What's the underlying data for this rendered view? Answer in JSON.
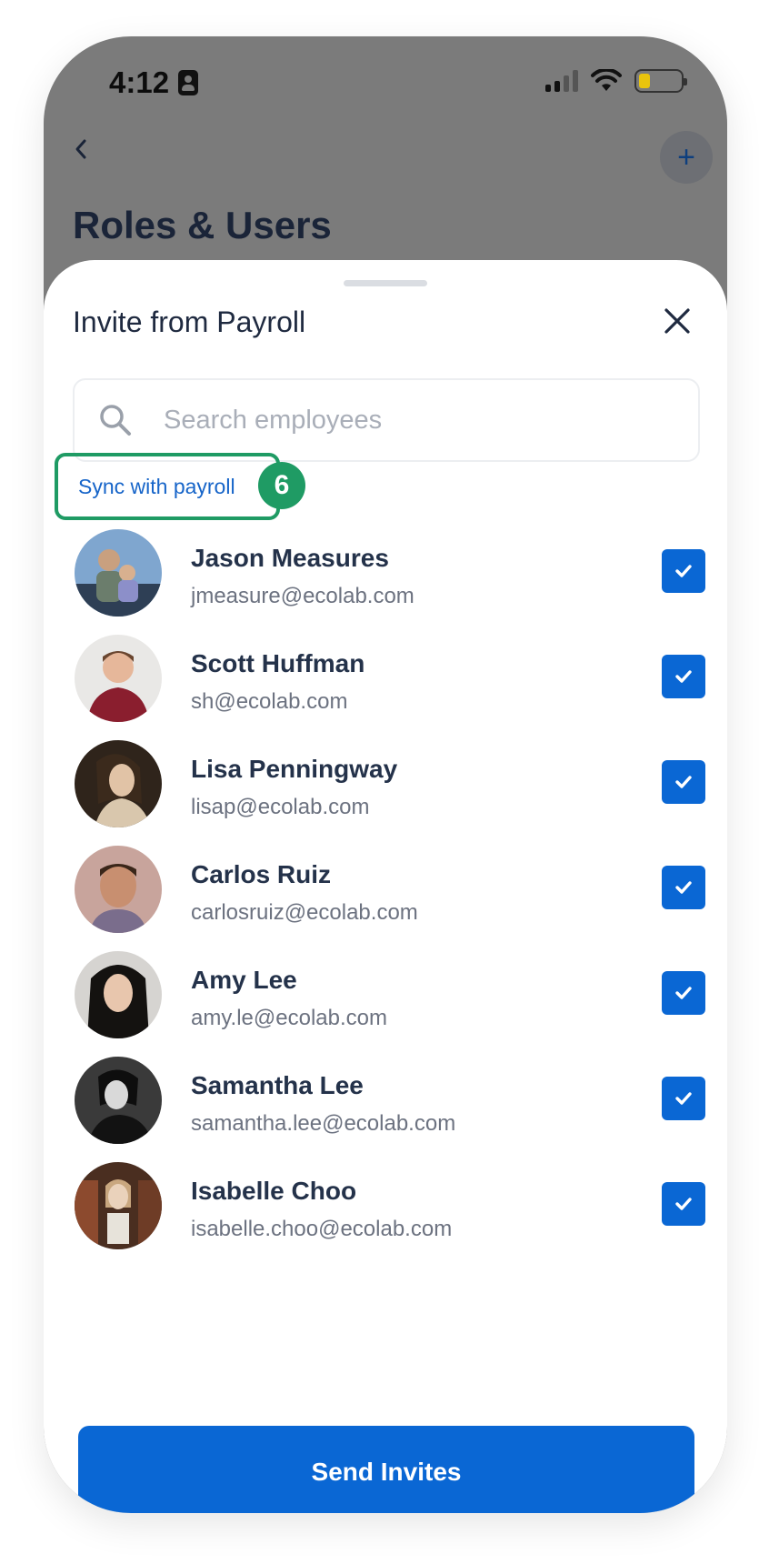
{
  "status": {
    "time": "4:12"
  },
  "header": {
    "title": "Roles & Users",
    "add_label": "+"
  },
  "sheet": {
    "title": "Invite from Payroll",
    "search": {
      "value": "",
      "placeholder": "Search employees"
    },
    "sync_label": "Sync with payroll",
    "step_number": "6",
    "employees": [
      {
        "name": "Jason Measures",
        "email": "jmeasure@ecolab.com",
        "checked": true
      },
      {
        "name": "Scott Huffman",
        "email": "sh@ecolab.com",
        "checked": true
      },
      {
        "name": "Lisa Penningway",
        "email": "lisap@ecolab.com",
        "checked": true
      },
      {
        "name": "Carlos Ruiz",
        "email": "carlosruiz@ecolab.com",
        "checked": true
      },
      {
        "name": "Amy Lee",
        "email": "amy.le@ecolab.com",
        "checked": true
      },
      {
        "name": "Samantha Lee",
        "email": "samantha.lee@ecolab.com",
        "checked": true
      },
      {
        "name": "Isabelle Choo",
        "email": "isabelle.choo@ecolab.com",
        "checked": true
      }
    ],
    "send_label": "Send Invites"
  },
  "colors": {
    "primary": "#0a67d4",
    "highlight": "#1f9b64",
    "overlay": "#7b7b7b"
  }
}
